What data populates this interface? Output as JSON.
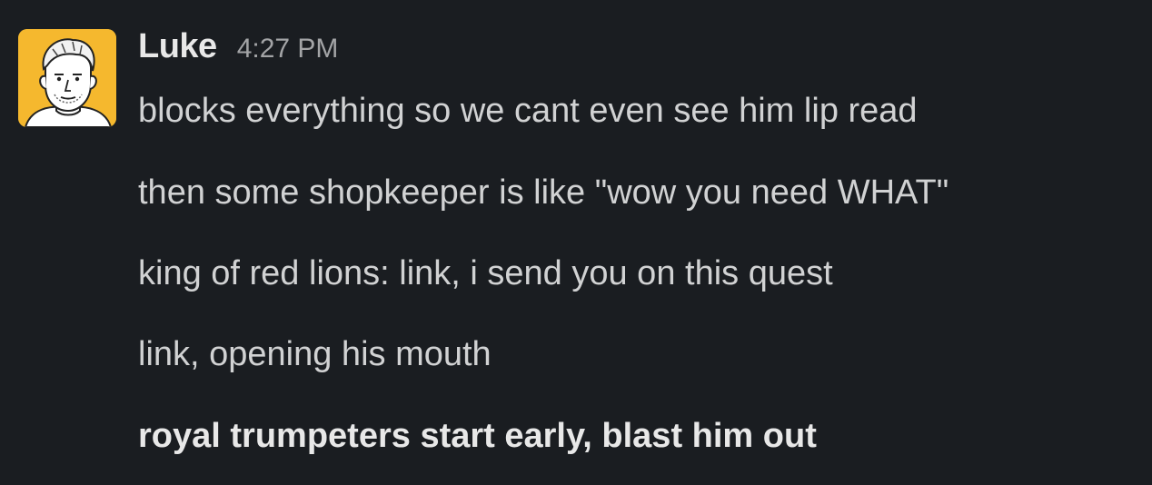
{
  "message": {
    "author": "Luke",
    "timestamp": "4:27 PM",
    "avatar_icon": "cartoon-portrait-avatar",
    "avatar_background": "#f5b82e",
    "lines": [
      "blocks everything so we cant even see him lip read",
      "then some shopkeeper is like \"wow you need WHAT\"",
      "king of red lions: link, i send you on this quest",
      "link, opening his mouth",
      "royal trumpeters start early, blast him out"
    ]
  }
}
